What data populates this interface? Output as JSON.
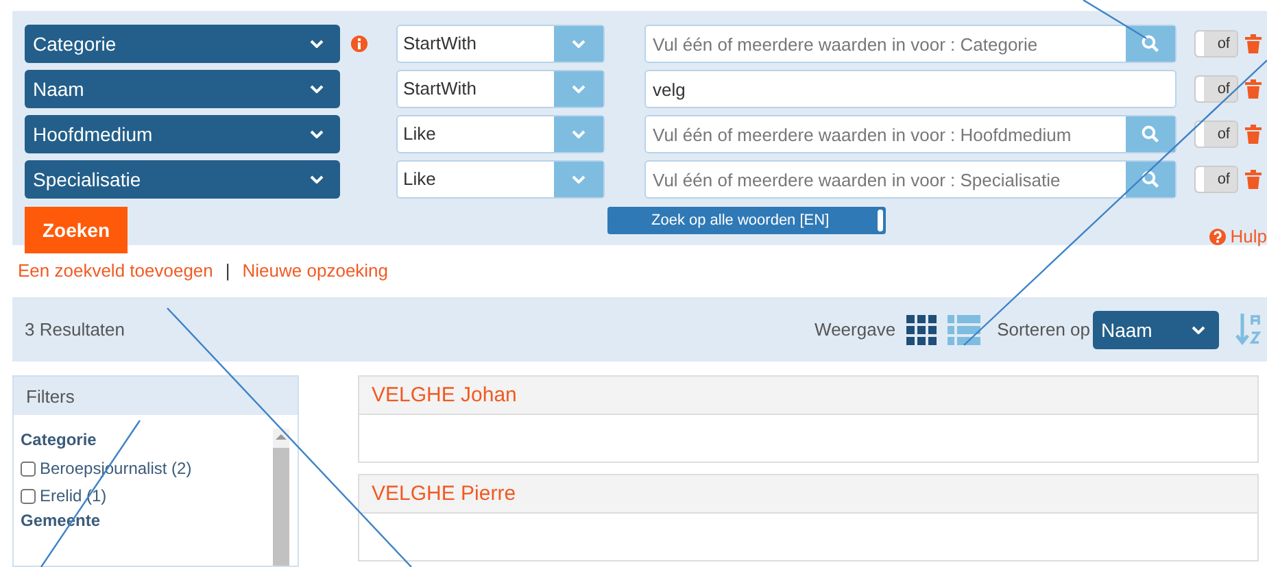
{
  "search_rows": [
    {
      "field": "Categorie",
      "info": true,
      "operator": "StartWith",
      "placeholder": "Vul één of meerdere waarden in voor : Categorie",
      "lookup": true,
      "connector": "of"
    },
    {
      "field": "Naam",
      "info": false,
      "operator": "StartWith",
      "value": "velg",
      "lookup": false,
      "connector": "of"
    },
    {
      "field": "Hoofdmedium",
      "info": false,
      "operator": "Like",
      "placeholder": "Vul één of meerdere waarden in voor : Hoofdmedium",
      "lookup": true,
      "connector": "of"
    },
    {
      "field": "Specialisatie",
      "info": false,
      "operator": "Like",
      "placeholder": "Vul één of meerdere waarden in voor : Specialisatie",
      "lookup": true,
      "connector": "of"
    }
  ],
  "search_button": "Zoeken",
  "all_words_toggle": {
    "label": "Zoek op alle woorden [EN]",
    "on": true
  },
  "help_link": "Hulp",
  "links": [
    "Een zoekveld toevoegen",
    "Nieuwe opzoeking"
  ],
  "links_separator": "|",
  "results_count": "3 Resultaten",
  "view": {
    "label": "Weergave",
    "options": [
      {
        "kind": "grid",
        "selected": true
      },
      {
        "kind": "list",
        "selected": false
      }
    ]
  },
  "sort": {
    "label": "Sorteren op",
    "value": "Naam"
  },
  "filters": {
    "title": "Filters",
    "groups": [
      {
        "title": "Categorie",
        "options": [
          {
            "label": "Beroepsjournalist (2)",
            "checked": false
          },
          {
            "label": "Erelid (1)",
            "checked": false
          }
        ]
      },
      {
        "title": "Gemeente"
      }
    ]
  },
  "results": [
    "VELGHE Johan",
    "VELGHE Pierre"
  ]
}
